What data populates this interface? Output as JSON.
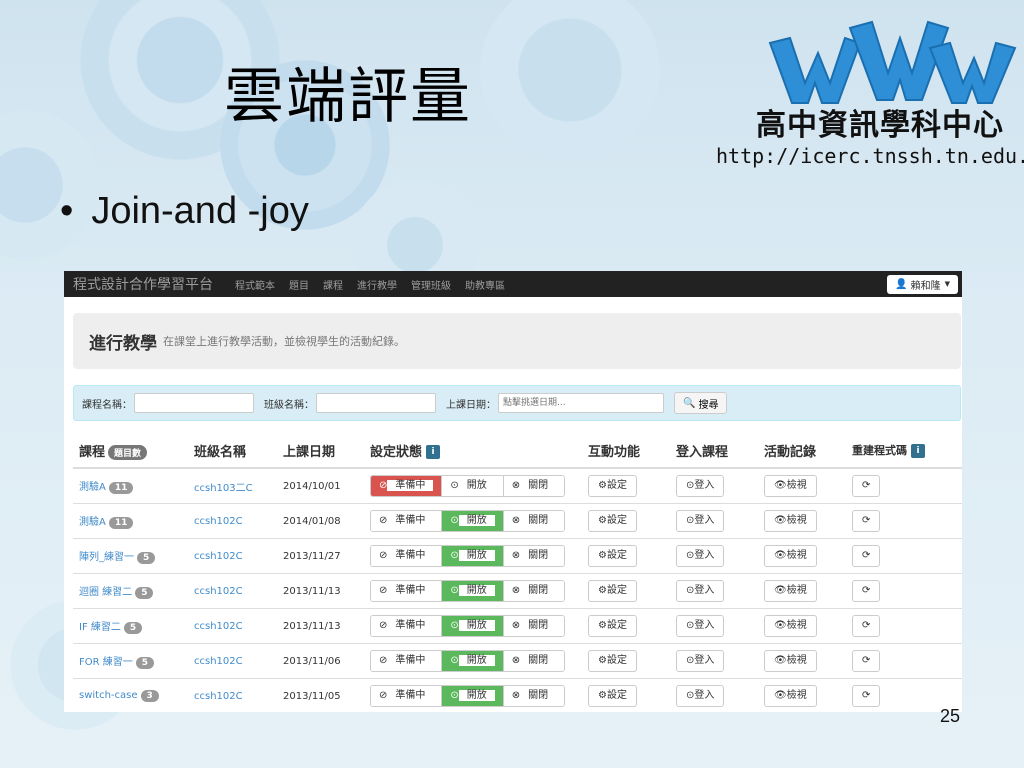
{
  "slide": {
    "title": "雲端評量",
    "bullet": "Join-and -joy",
    "page_number": "25",
    "brand_name": "高中資訊學科中心",
    "brand_url": "http://icerc.tnssh.tn.edu.tw"
  },
  "app": {
    "brand": "程式設計合作學習平台",
    "nav": [
      "程式範本",
      "題目",
      "課程",
      "進行教學",
      "管理班級",
      "助教專區"
    ],
    "user": "賴和隆",
    "jumbotron": {
      "heading": "進行教學",
      "subtitle": "在課堂上進行教學活動，並檢視學生的活動紀錄。"
    },
    "filter": {
      "course_label": "課程名稱：",
      "class_label": "班級名稱：",
      "date_label": "上課日期：",
      "date_placeholder": "點擊挑選日期...",
      "search_label": "搜尋"
    },
    "table": {
      "headers": {
        "course": "課程",
        "course_badge": "題目數",
        "class": "班級名稱",
        "date": "上課日期",
        "status": "設定狀態",
        "interact": "互動功能",
        "login": "登入課程",
        "record": "活動記錄",
        "rebuild": "重建程式碼"
      },
      "status_labels": {
        "prep": "準備中",
        "open": "開放",
        "close": "關閉"
      },
      "action_labels": {
        "setting": "設定",
        "login": "登入",
        "view": "檢視"
      },
      "rows": [
        {
          "course": "測驗A",
          "count": "11",
          "class": "ccsh103二C",
          "date": "2014/10/01",
          "status": "prep"
        },
        {
          "course": "測驗A",
          "count": "11",
          "class": "ccsh102C",
          "date": "2014/01/08",
          "status": "open"
        },
        {
          "course": "陣列_練習一",
          "count": "5",
          "class": "ccsh102C",
          "date": "2013/11/27",
          "status": "open"
        },
        {
          "course": "迴圈 練習二",
          "count": "5",
          "class": "ccsh102C",
          "date": "2013/11/13",
          "status": "open"
        },
        {
          "course": "IF 練習二",
          "count": "5",
          "class": "ccsh102C",
          "date": "2013/11/13",
          "status": "open"
        },
        {
          "course": "FOR 練習一",
          "count": "5",
          "class": "ccsh102C",
          "date": "2013/11/06",
          "status": "open"
        },
        {
          "course": "switch-case",
          "count": "3",
          "class": "ccsh102C",
          "date": "2013/11/05",
          "status": "open"
        }
      ]
    }
  }
}
